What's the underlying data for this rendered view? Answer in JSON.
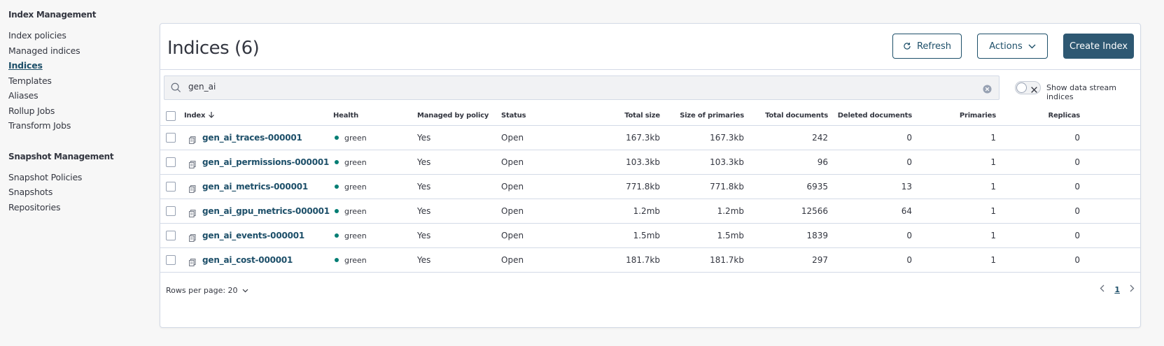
{
  "sidebar": {
    "index_management_title": "Index Management",
    "index_items": [
      {
        "label": "Index policies",
        "active": false
      },
      {
        "label": "Managed indices",
        "active": false
      },
      {
        "label": "Indices",
        "active": true
      },
      {
        "label": "Templates",
        "active": false
      },
      {
        "label": "Aliases",
        "active": false
      },
      {
        "label": "Rollup Jobs",
        "active": false
      },
      {
        "label": "Transform Jobs",
        "active": false
      }
    ],
    "snapshot_management_title": "Snapshot Management",
    "snapshot_items": [
      {
        "label": "Snapshot Policies"
      },
      {
        "label": "Snapshots"
      },
      {
        "label": "Repositories"
      }
    ]
  },
  "header": {
    "title": "Indices (6)",
    "refresh_label": "Refresh",
    "actions_label": "Actions",
    "create_label": "Create Index"
  },
  "search": {
    "value": "gen_ai",
    "toggle_label": "Show data stream indices"
  },
  "table": {
    "columns": {
      "index": "Index",
      "health": "Health",
      "managed": "Managed by policy",
      "status": "Status",
      "total_size": "Total size",
      "size_primaries": "Size of primaries",
      "total_docs": "Total documents",
      "deleted_docs": "Deleted documents",
      "primaries": "Primaries",
      "replicas": "Replicas"
    },
    "rows": [
      {
        "index": "gen_ai_traces-000001",
        "health": "green",
        "managed": "Yes",
        "status": "Open",
        "total_size": "167.3kb",
        "size_primaries": "167.3kb",
        "total_docs": "242",
        "deleted_docs": "0",
        "primaries": "1",
        "replicas": "0"
      },
      {
        "index": "gen_ai_permissions-000001",
        "health": "green",
        "managed": "Yes",
        "status": "Open",
        "total_size": "103.3kb",
        "size_primaries": "103.3kb",
        "total_docs": "96",
        "deleted_docs": "0",
        "primaries": "1",
        "replicas": "0"
      },
      {
        "index": "gen_ai_metrics-000001",
        "health": "green",
        "managed": "Yes",
        "status": "Open",
        "total_size": "771.8kb",
        "size_primaries": "771.8kb",
        "total_docs": "6935",
        "deleted_docs": "13",
        "primaries": "1",
        "replicas": "0"
      },
      {
        "index": "gen_ai_gpu_metrics-000001",
        "health": "green",
        "managed": "Yes",
        "status": "Open",
        "total_size": "1.2mb",
        "size_primaries": "1.2mb",
        "total_docs": "12566",
        "deleted_docs": "64",
        "primaries": "1",
        "replicas": "0"
      },
      {
        "index": "gen_ai_events-000001",
        "health": "green",
        "managed": "Yes",
        "status": "Open",
        "total_size": "1.5mb",
        "size_primaries": "1.5mb",
        "total_docs": "1839",
        "deleted_docs": "0",
        "primaries": "1",
        "replicas": "0"
      },
      {
        "index": "gen_ai_cost-000001",
        "health": "green",
        "managed": "Yes",
        "status": "Open",
        "total_size": "181.7kb",
        "size_primaries": "181.7kb",
        "total_docs": "297",
        "deleted_docs": "0",
        "primaries": "1",
        "replicas": "0"
      }
    ]
  },
  "footer": {
    "rows_per_page": "Rows per page: 20",
    "current_page": "1"
  },
  "colors": {
    "accent": "#1d4f69",
    "primary_button": "#2e5872",
    "health_green": "#017d73"
  }
}
